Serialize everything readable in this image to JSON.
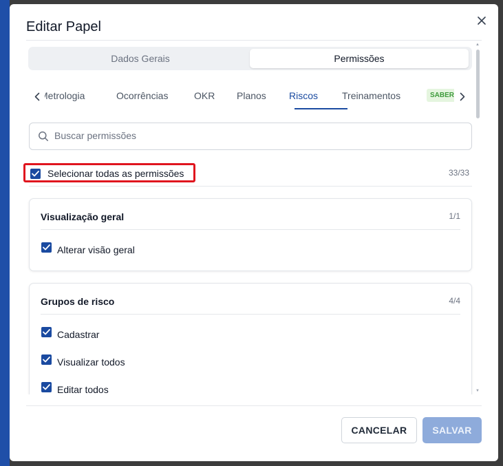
{
  "modal": {
    "title": "Editar Papel"
  },
  "segments": {
    "general": "Dados Gerais",
    "permissions": "Permissões"
  },
  "tabs": {
    "items": [
      "Metrologia",
      "Ocorrências",
      "OKR",
      "Planos",
      "Riscos",
      "Treinamentos"
    ],
    "active": "Riscos",
    "badge": "SABER"
  },
  "search": {
    "placeholder": "Buscar permissões",
    "value": ""
  },
  "select_all": {
    "label": "Selecionar todas as permissões",
    "checked": true,
    "count": "33/33"
  },
  "groups": [
    {
      "title": "Visualização geral",
      "count": "1/1",
      "permissions": [
        {
          "label": "Alterar visão geral",
          "checked": true
        }
      ]
    },
    {
      "title": "Grupos de risco",
      "count": "4/4",
      "permissions": [
        {
          "label": "Cadastrar",
          "checked": true
        },
        {
          "label": "Visualizar todos",
          "checked": true
        },
        {
          "label": "Editar todos",
          "checked": true
        }
      ]
    }
  ],
  "footer": {
    "cancel": "CANCELAR",
    "save": "SALVAR"
  },
  "colors": {
    "accent": "#1a4aa0",
    "highlight": "#e0141e",
    "badge_text": "#3f9b3c",
    "badge_bg": "#e5f5df",
    "save_disabled": "#8eabdb"
  },
  "icons": {
    "close": "close-icon",
    "search": "search-icon",
    "tab_prev": "chevron-left-icon",
    "tab_next": "chevron-right-icon",
    "checkbox": "check-icon"
  }
}
